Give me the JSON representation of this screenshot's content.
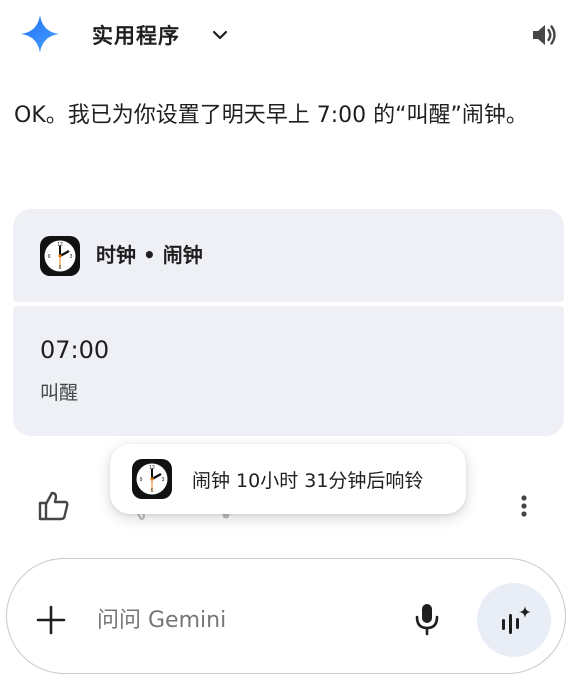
{
  "header": {
    "app_name": "实用程序",
    "logo_icon": "gemini-sparkle-icon",
    "dropdown_icon": "chevron-down-icon",
    "speaker_icon": "volume-icon"
  },
  "response": {
    "text": "OK。我已为你设置了明天早上 7:00 的“叫醒”闹钟。"
  },
  "alarm_card": {
    "title": "时钟 • 闹钟",
    "time": "07:00",
    "label": "叫醒"
  },
  "toast": {
    "text": "闹钟 10小时 31分钟后响铃"
  },
  "actions": {
    "thumb_icon": "thumbs-up-icon",
    "more_icon": "more-vert-icon"
  },
  "composer": {
    "placeholder": "问问 Gemini",
    "plus_icon": "plus-icon",
    "mic_icon": "mic-icon",
    "live_icon": "gemini-live-icon"
  },
  "colors": {
    "card_bg": "#eef0f5",
    "live_btn_bg": "#e9eef6",
    "gemini_blue": "#4285f4"
  }
}
